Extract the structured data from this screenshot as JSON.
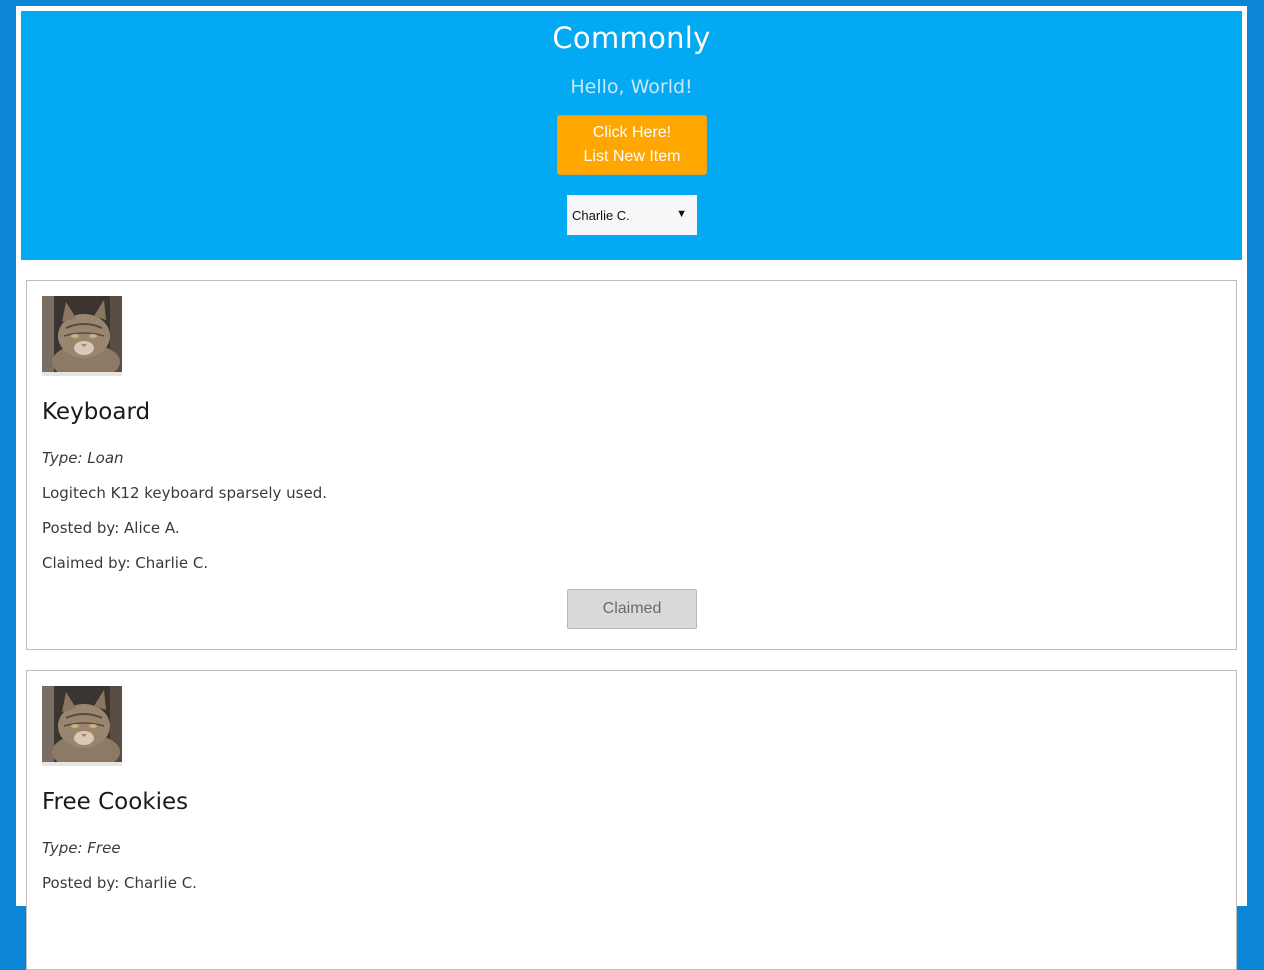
{
  "header": {
    "title": "Commonly",
    "greeting": "Hello, World!",
    "list_button": {
      "line1": "Click Here!",
      "line2": "List New Item"
    },
    "user_select": {
      "selected": "Charlie C."
    }
  },
  "items": [
    {
      "title": "Keyboard",
      "type": "Type: Loan",
      "description": "Logitech K12 keyboard sparsely used.",
      "posted_by": "Posted by: Alice A.",
      "claimed_by": "Claimed by: Charlie C.",
      "button": "Claimed"
    },
    {
      "title": "Free Cookies",
      "type": "Type: Free",
      "posted_by": "Posted by: Charlie C."
    }
  ],
  "colors": {
    "page_bg": "#0a86d4",
    "header_bg": "#04a9f4",
    "accent_button": "#ffa600"
  }
}
